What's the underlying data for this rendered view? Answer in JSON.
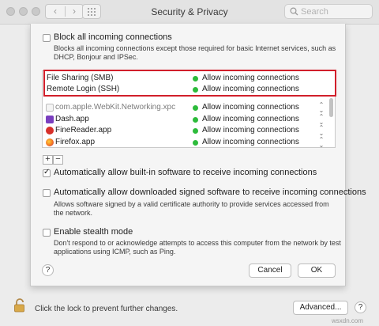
{
  "window": {
    "title": "Security & Privacy",
    "search_placeholder": "Search"
  },
  "options": {
    "block_all": {
      "label": "Block all incoming connections",
      "checked": false,
      "description_line1": "Blocks all incoming connections except those required for basic Internet services, such as",
      "description_line2": "DHCP, Bonjour and IPSec."
    },
    "auto_builtin": {
      "label": "Automatically allow built-in software to receive incoming connections",
      "checked": true
    },
    "auto_signed": {
      "label": "Automatically allow downloaded signed software to receive incoming connections",
      "checked": false,
      "description_line1": "Allows software signed by a valid certificate authority to provide services accessed from",
      "description_line2": "the network."
    },
    "stealth": {
      "label": "Enable stealth mode",
      "checked": false,
      "description_line1": "Don't respond to or acknowledge attempts to access this computer from the network by test",
      "description_line2": "applications using ICMP, such as Ping."
    }
  },
  "apps": [
    {
      "name": "File Sharing (SMB)",
      "status": "Allow incoming connections",
      "icon": "none",
      "stepper": false
    },
    {
      "name": "Remote Login (SSH)",
      "status": "Allow incoming connections",
      "icon": "none",
      "stepper": false
    },
    {
      "name": "com.apple.WebKit.Networking.xpc",
      "status": "Allow incoming connections",
      "icon": "generic-app-icon",
      "stepper": true
    },
    {
      "name": "Dash.app",
      "status": "Allow incoming connections",
      "icon": "dash-icon",
      "stepper": true
    },
    {
      "name": "FineReader.app",
      "status": "Allow incoming connections",
      "icon": "finereader-icon",
      "stepper": true
    },
    {
      "name": "Firefox.app",
      "status": "Allow incoming connections",
      "icon": "firefox-icon",
      "stepper": true
    }
  ],
  "list_controls": {
    "add": "+",
    "remove": "−"
  },
  "buttons": {
    "help": "?",
    "cancel": "Cancel",
    "ok": "OK",
    "advanced": "Advanced..."
  },
  "footer": {
    "lock_text": "Click the lock to prevent further changes."
  },
  "watermark": "wsxdn.com",
  "colors": {
    "status_dot": "#2dbb3b",
    "highlight": "#d11f2b"
  }
}
